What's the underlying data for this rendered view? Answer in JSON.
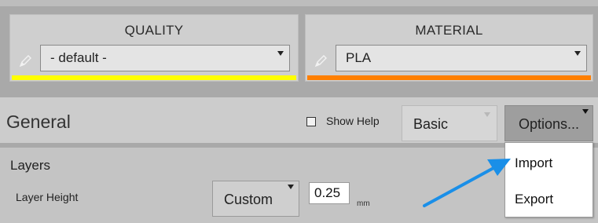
{
  "quality": {
    "title": "QUALITY",
    "selected": "- default -",
    "accent_color": "#ffff00"
  },
  "material": {
    "title": "MATERIAL",
    "selected": "PLA",
    "accent_color": "#ff7f00"
  },
  "general": {
    "title": "General",
    "show_help_label": "Show Help",
    "show_help_checked": false,
    "mode_selected": "Basic",
    "options_label": "Options..."
  },
  "layers": {
    "title": "Layers",
    "layer_height_label": "Layer Height",
    "layer_height_preset": "Custom",
    "layer_height_value": "0.25",
    "layer_height_unit": "mm"
  },
  "options_menu": {
    "items": [
      "Import",
      "Export"
    ]
  },
  "annotation": {
    "arrow_color": "#1a8fe8"
  },
  "icons": [
    "pencil-icon",
    "chevron-down-icon",
    "checkbox-icon"
  ]
}
